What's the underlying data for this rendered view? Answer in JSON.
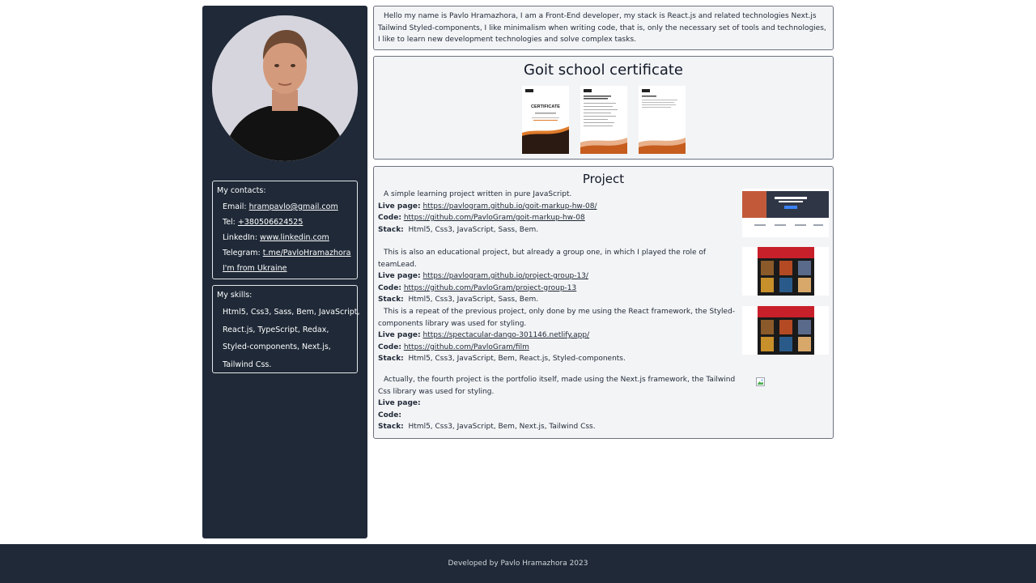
{
  "intro": {
    "text": "Hello my name is Pavlo Hramazhora, I am a Front-End developer, my stack is React.js and related technologies Next.js Tailwind Styled-components, I like minimalism when writing code, that is, only the necessary set of tools and technologies, I like to learn new development technologies and solve complex tasks."
  },
  "contacts": {
    "title": "My contacts:",
    "email_label": "Email:",
    "email": "hrampavlo@gmail.com",
    "tel_label": "Tel:",
    "tel": "+380506624525",
    "linkedin_label": "LinkedIn:",
    "linkedin": "www.linkedin.com",
    "telegram_label": "Telegram:",
    "telegram": "t.me/PavloHramazhora",
    "ukraine": "I'm from Ukraine"
  },
  "skills": {
    "title": "My skills:",
    "lines": [
      "Html5, Css3, Sass, Bem, JavaScript,",
      "React.js, TypeScript, Redax,",
      "Styled-components, Next.js,",
      "Tailwind Css."
    ]
  },
  "certificate": {
    "title": "Goit school certificate",
    "cert_heading": "CERTIFICATE"
  },
  "projects": {
    "title": "Project",
    "live_label": "Live page:",
    "code_label": "Code:",
    "stack_label": "Stack:",
    "items": [
      {
        "desc": "A simple learning project written in pure JavaScript.",
        "live": "https://pavlogram.github.io/goit-markup-hw-08/",
        "code": "https://github.com/PavloGram/goit-markup-hw-08",
        "stack": "Html5, Css3, JavaScript, Sass, Bem."
      },
      {
        "desc": "This is also an educational project, but already a group one, in which I played the role of teamLead.",
        "live": "https://pavlogram.github.io/project-group-13/",
        "code": "https://github.com/PavloGram/project-group-13",
        "stack": "Html5, Css3, JavaScript, Sass, Bem."
      },
      {
        "desc": "This is a repeat of the previous project, only done by me using the React framework, the Styled-components library was used for styling.",
        "live": "https://spectacular-dango-301146.netlify.app/",
        "code": "https://github.com/PavloGram/film",
        "stack": "Html5, Css3, JavaScript, Bem, React.js, Styled-components."
      },
      {
        "desc": "Actually, the fourth project is the portfolio itself, made using the Next.js framework, the Tailwind Css library was used for styling.",
        "live": "",
        "code": "",
        "stack": "Html5, Css3, JavaScript, Bem, Next.js, Tailwind Css."
      }
    ]
  },
  "footer": {
    "text": "Developed by Pavlo Hramazhora 2023"
  },
  "colors": {
    "sidebar": "#1f2937",
    "footer": "#1f2937",
    "box_bg": "#f3f4f6",
    "accent_orange": "#e07b2a"
  },
  "icons": [
    "broken-image-icon"
  ]
}
